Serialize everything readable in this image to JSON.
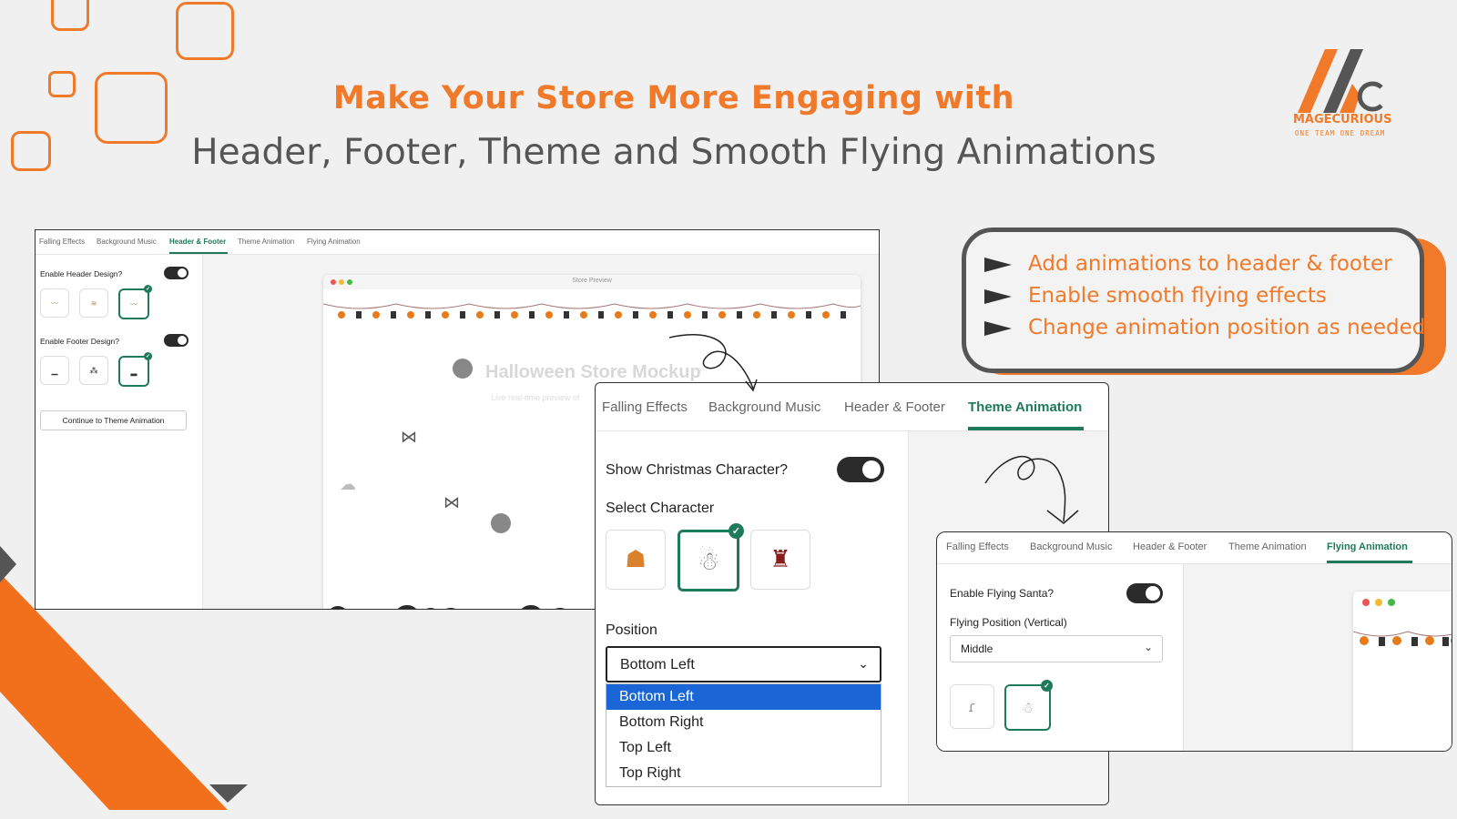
{
  "headline": {
    "line1": "Make Your Store More Engaging with",
    "line2": "Header, Footer, Theme and Smooth Flying Animations"
  },
  "logo": {
    "name": "MAGECURIOUS",
    "tagline": "ONE TEAM ONE DREAM"
  },
  "callout": {
    "bullets": [
      "Add animations to header & footer",
      "Enable smooth flying effects",
      "Change animation position as needed"
    ]
  },
  "colors": {
    "accent": "#f07a2a",
    "active_tab": "#1f7a5c",
    "highlight": "#1a66d6"
  },
  "panel1": {
    "tabs": [
      "Falling Effects",
      "Background Music",
      "Header & Footer",
      "Theme Animation",
      "Flying Animation"
    ],
    "active_tab": "Header & Footer",
    "header_toggle_label": "Enable Header Design?",
    "footer_toggle_label": "Enable Footer Design?",
    "continue_button": "Continue to Theme Animation",
    "preview_label": "Store Preview",
    "preview_title": "Halloween Store Mockup",
    "preview_subtitle": "Live real-time preview of"
  },
  "panel2": {
    "tabs": [
      "Falling Effects",
      "Background Music",
      "Header & Footer",
      "Theme Animation"
    ],
    "active_tab": "Theme Animation",
    "show_character_label": "Show Christmas Character?",
    "select_character_label": "Select Character",
    "position_label": "Position",
    "position_value": "Bottom Left",
    "position_options": [
      "Bottom Left",
      "Bottom Right",
      "Top Left",
      "Top Right"
    ]
  },
  "panel3": {
    "tabs": [
      "Falling Effects",
      "Background Music",
      "Header & Footer",
      "Theme Animation",
      "Flying Animation"
    ],
    "active_tab": "Flying Animation",
    "flying_toggle_label": "Enable Flying Santa?",
    "flying_position_label": "Flying Position (Vertical)",
    "flying_position_value": "Middle"
  }
}
